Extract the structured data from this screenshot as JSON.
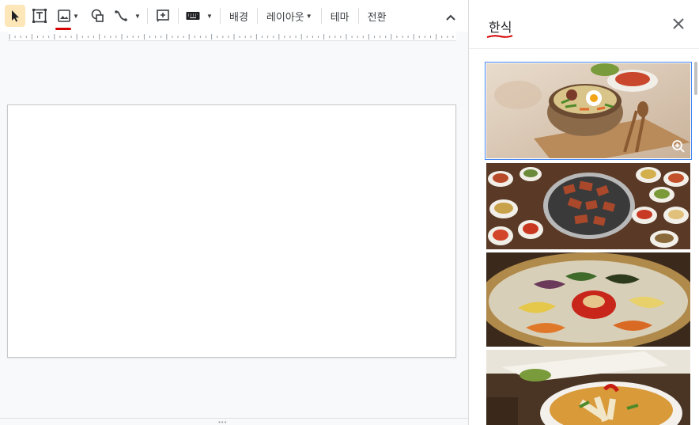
{
  "toolbar": {
    "tools": [
      {
        "name": "select-tool",
        "icon": "cursor-arrow-icon",
        "active": true
      },
      {
        "name": "textbox-tool",
        "icon": "textbox-icon"
      },
      {
        "name": "image-tool",
        "icon": "image-icon",
        "has_dropdown": true
      },
      {
        "name": "shape-tool",
        "icon": "shape-icon"
      },
      {
        "name": "line-tool",
        "icon": "line-icon",
        "has_dropdown": true
      },
      {
        "name": "comment-tool",
        "icon": "add-comment-icon"
      },
      {
        "name": "input-tool",
        "icon": "keyboard-icon",
        "has_dropdown": true
      }
    ],
    "background_label": "배경",
    "layout_label": "레이아웃",
    "theme_label": "테마",
    "transition_label": "전환"
  },
  "panel": {
    "title": "한식",
    "close_icon": "close-icon",
    "results": [
      {
        "name": "bibimbap-stone-bowl-image",
        "selected": true
      },
      {
        "name": "korean-bbq-grill-image",
        "selected": false
      },
      {
        "name": "bibimbap-brass-bowl-image",
        "selected": false
      },
      {
        "name": "noodle-soup-image",
        "selected": false
      }
    ]
  },
  "colors": {
    "accent_red": "#d50000",
    "active_tool_bg": "#fde7b8",
    "selection_blue": "#4285f4"
  }
}
